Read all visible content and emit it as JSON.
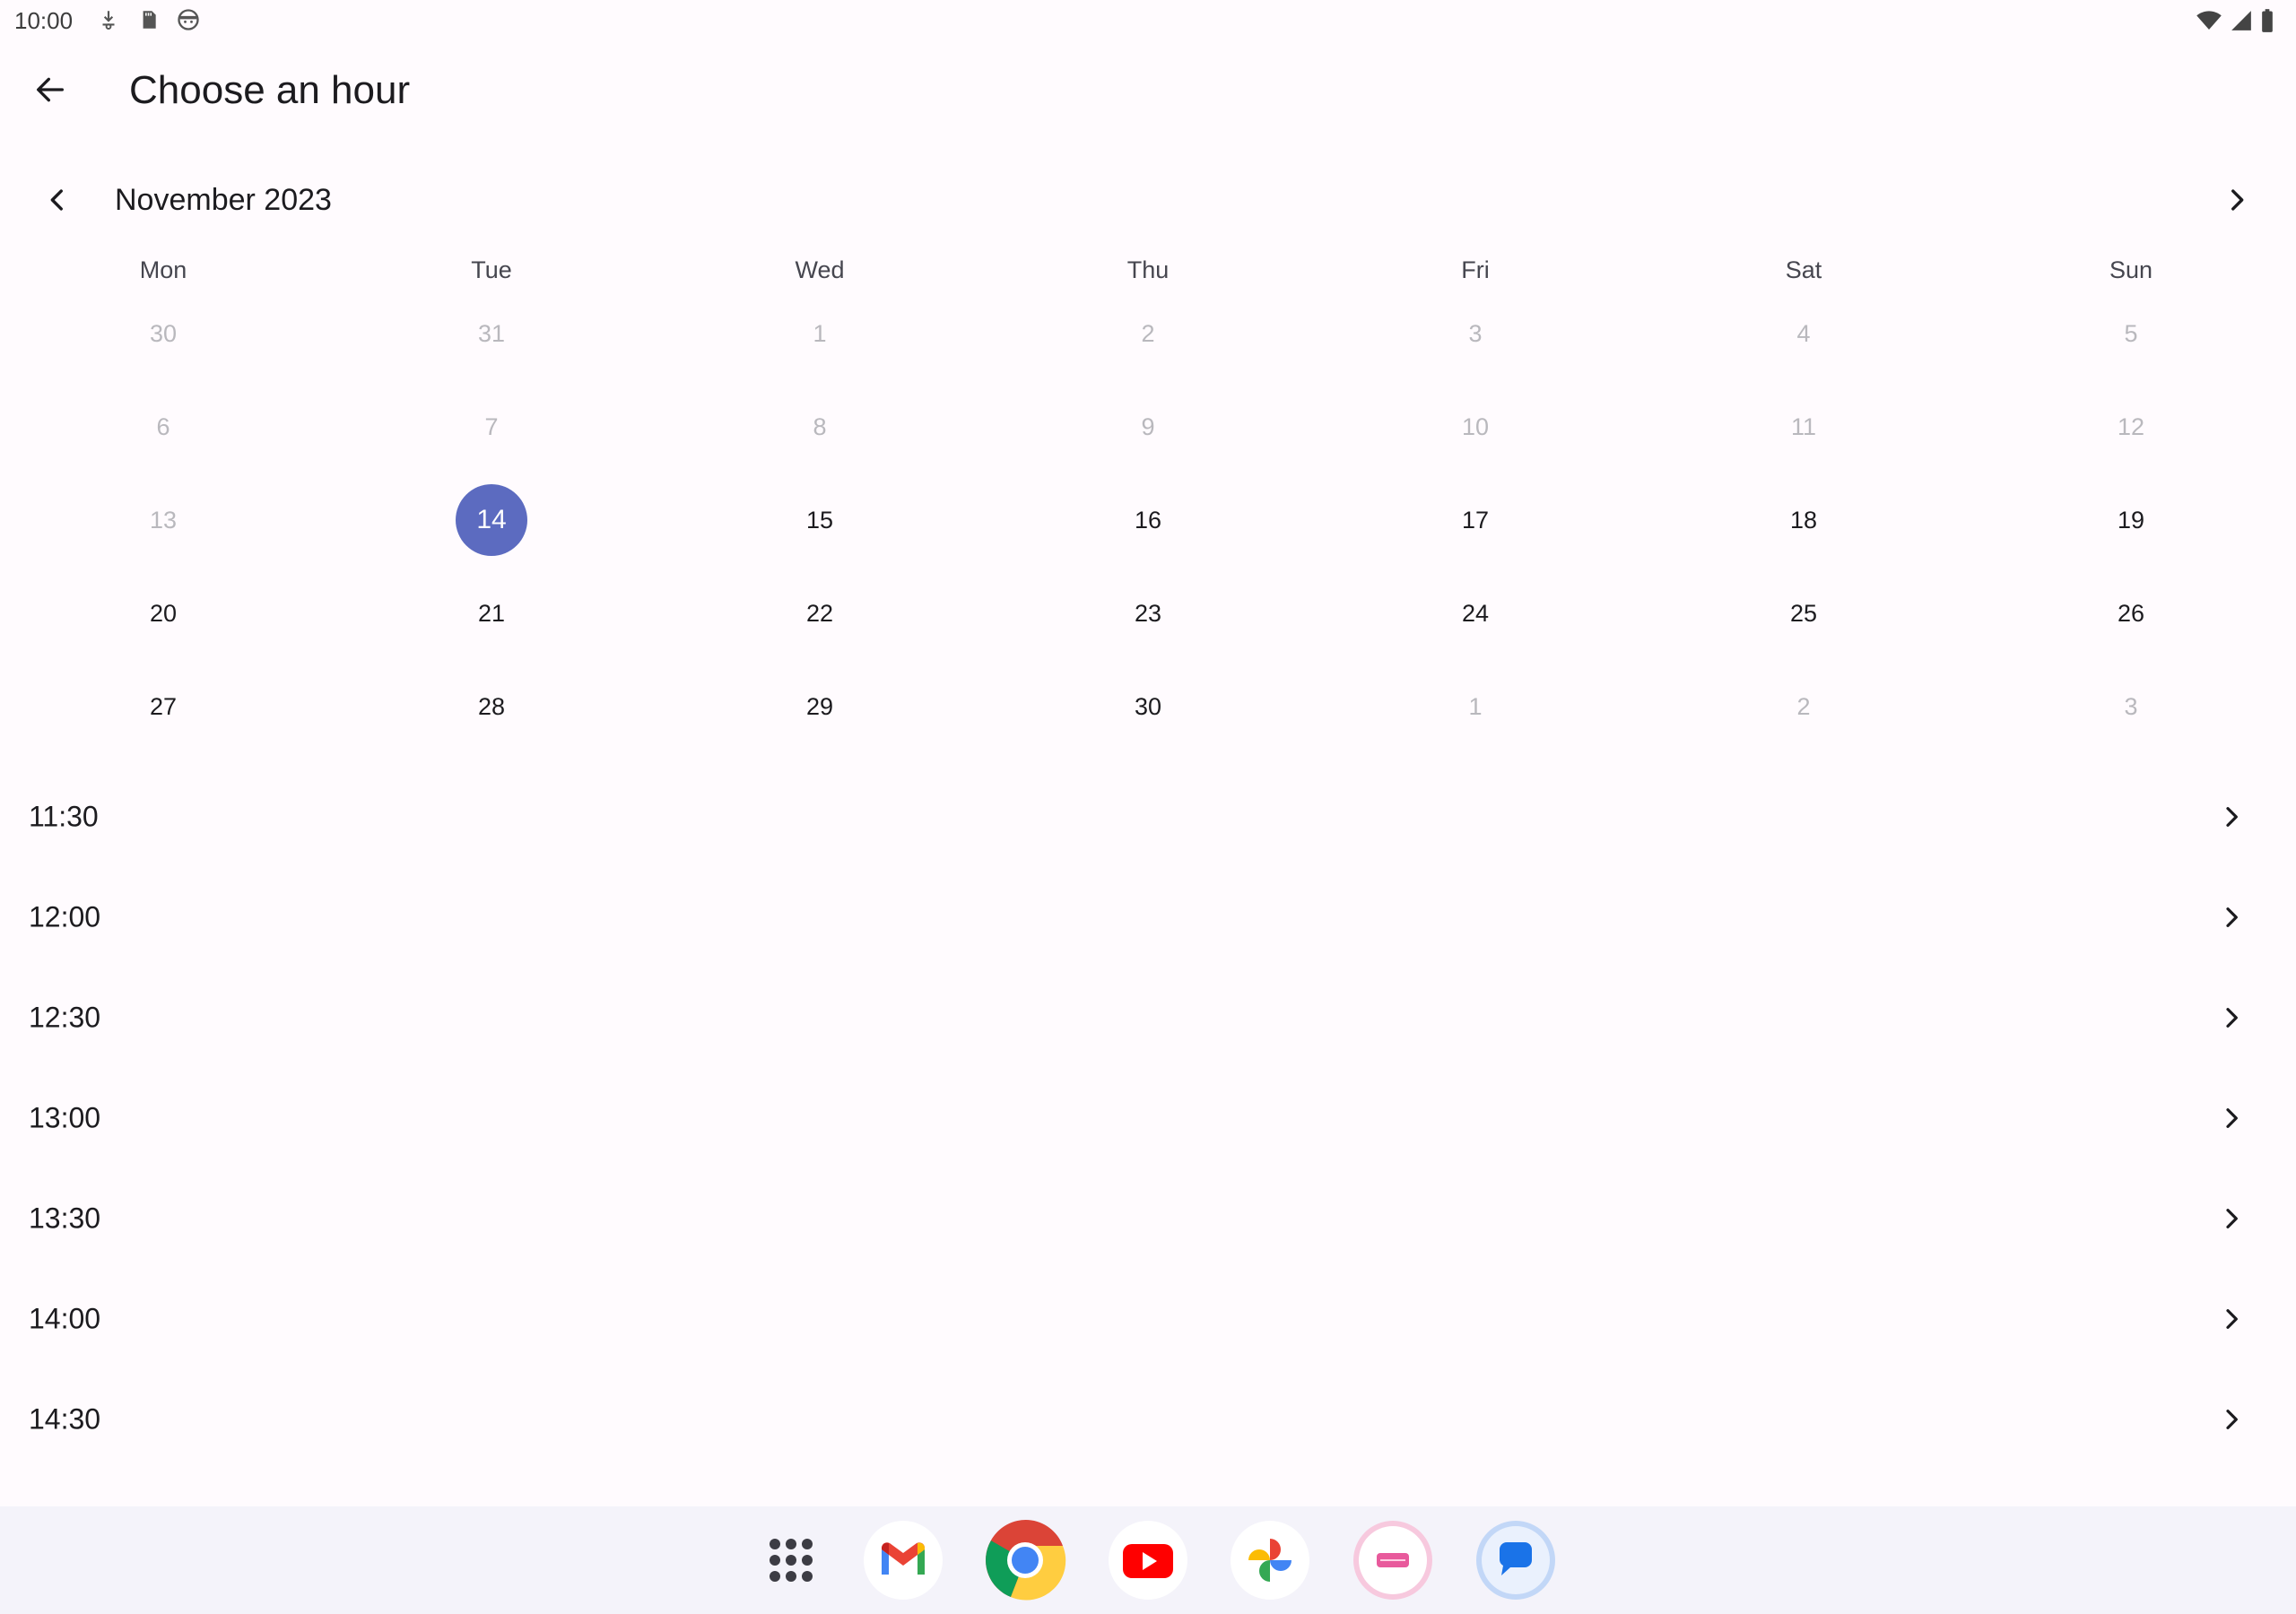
{
  "status_bar": {
    "time": "10:00",
    "left_icons": [
      "download-icon",
      "sd-card-icon",
      "face-icon"
    ],
    "right_icons": [
      "wifi-icon",
      "signal-icon",
      "battery-icon"
    ]
  },
  "app_bar": {
    "back_icon": "arrow-back-icon",
    "title": "Choose an hour"
  },
  "calendar": {
    "month_label": "November 2023",
    "prev_icon": "chevron-left-icon",
    "next_icon": "chevron-right-icon",
    "weekdays": [
      "Mon",
      "Tue",
      "Wed",
      "Thu",
      "Fri",
      "Sat",
      "Sun"
    ],
    "weeks": [
      [
        {
          "label": "30",
          "state": "muted"
        },
        {
          "label": "31",
          "state": "muted"
        },
        {
          "label": "1",
          "state": "muted"
        },
        {
          "label": "2",
          "state": "muted"
        },
        {
          "label": "3",
          "state": "muted"
        },
        {
          "label": "4",
          "state": "muted"
        },
        {
          "label": "5",
          "state": "muted"
        }
      ],
      [
        {
          "label": "6",
          "state": "muted"
        },
        {
          "label": "7",
          "state": "muted"
        },
        {
          "label": "8",
          "state": "muted"
        },
        {
          "label": "9",
          "state": "muted"
        },
        {
          "label": "10",
          "state": "muted"
        },
        {
          "label": "11",
          "state": "muted"
        },
        {
          "label": "12",
          "state": "muted"
        }
      ],
      [
        {
          "label": "13",
          "state": "muted"
        },
        {
          "label": "14",
          "state": "selected"
        },
        {
          "label": "15",
          "state": "active"
        },
        {
          "label": "16",
          "state": "active"
        },
        {
          "label": "17",
          "state": "active"
        },
        {
          "label": "18",
          "state": "active"
        },
        {
          "label": "19",
          "state": "active"
        }
      ],
      [
        {
          "label": "20",
          "state": "active"
        },
        {
          "label": "21",
          "state": "active"
        },
        {
          "label": "22",
          "state": "active"
        },
        {
          "label": "23",
          "state": "active"
        },
        {
          "label": "24",
          "state": "active"
        },
        {
          "label": "25",
          "state": "active"
        },
        {
          "label": "26",
          "state": "active"
        }
      ],
      [
        {
          "label": "27",
          "state": "active"
        },
        {
          "label": "28",
          "state": "active"
        },
        {
          "label": "29",
          "state": "active"
        },
        {
          "label": "30",
          "state": "active"
        },
        {
          "label": "1",
          "state": "muted"
        },
        {
          "label": "2",
          "state": "muted"
        },
        {
          "label": "3",
          "state": "muted"
        }
      ]
    ],
    "selected_color": "#5c6bc0"
  },
  "time_slots": [
    "11:30",
    "12:00",
    "12:30",
    "13:00",
    "13:30",
    "14:00",
    "14:30"
  ],
  "dock": {
    "apps": [
      {
        "name": "app-drawer-icon"
      },
      {
        "name": "gmail-icon"
      },
      {
        "name": "chrome-icon"
      },
      {
        "name": "youtube-icon"
      },
      {
        "name": "photos-icon"
      },
      {
        "name": "app-pink-icon"
      },
      {
        "name": "messages-icon"
      }
    ]
  },
  "colors": {
    "background": "#fffbfe",
    "accent": "#5c6bc0",
    "muted_text": "#b9b8bd",
    "dock_background": "#f4f3fa"
  }
}
